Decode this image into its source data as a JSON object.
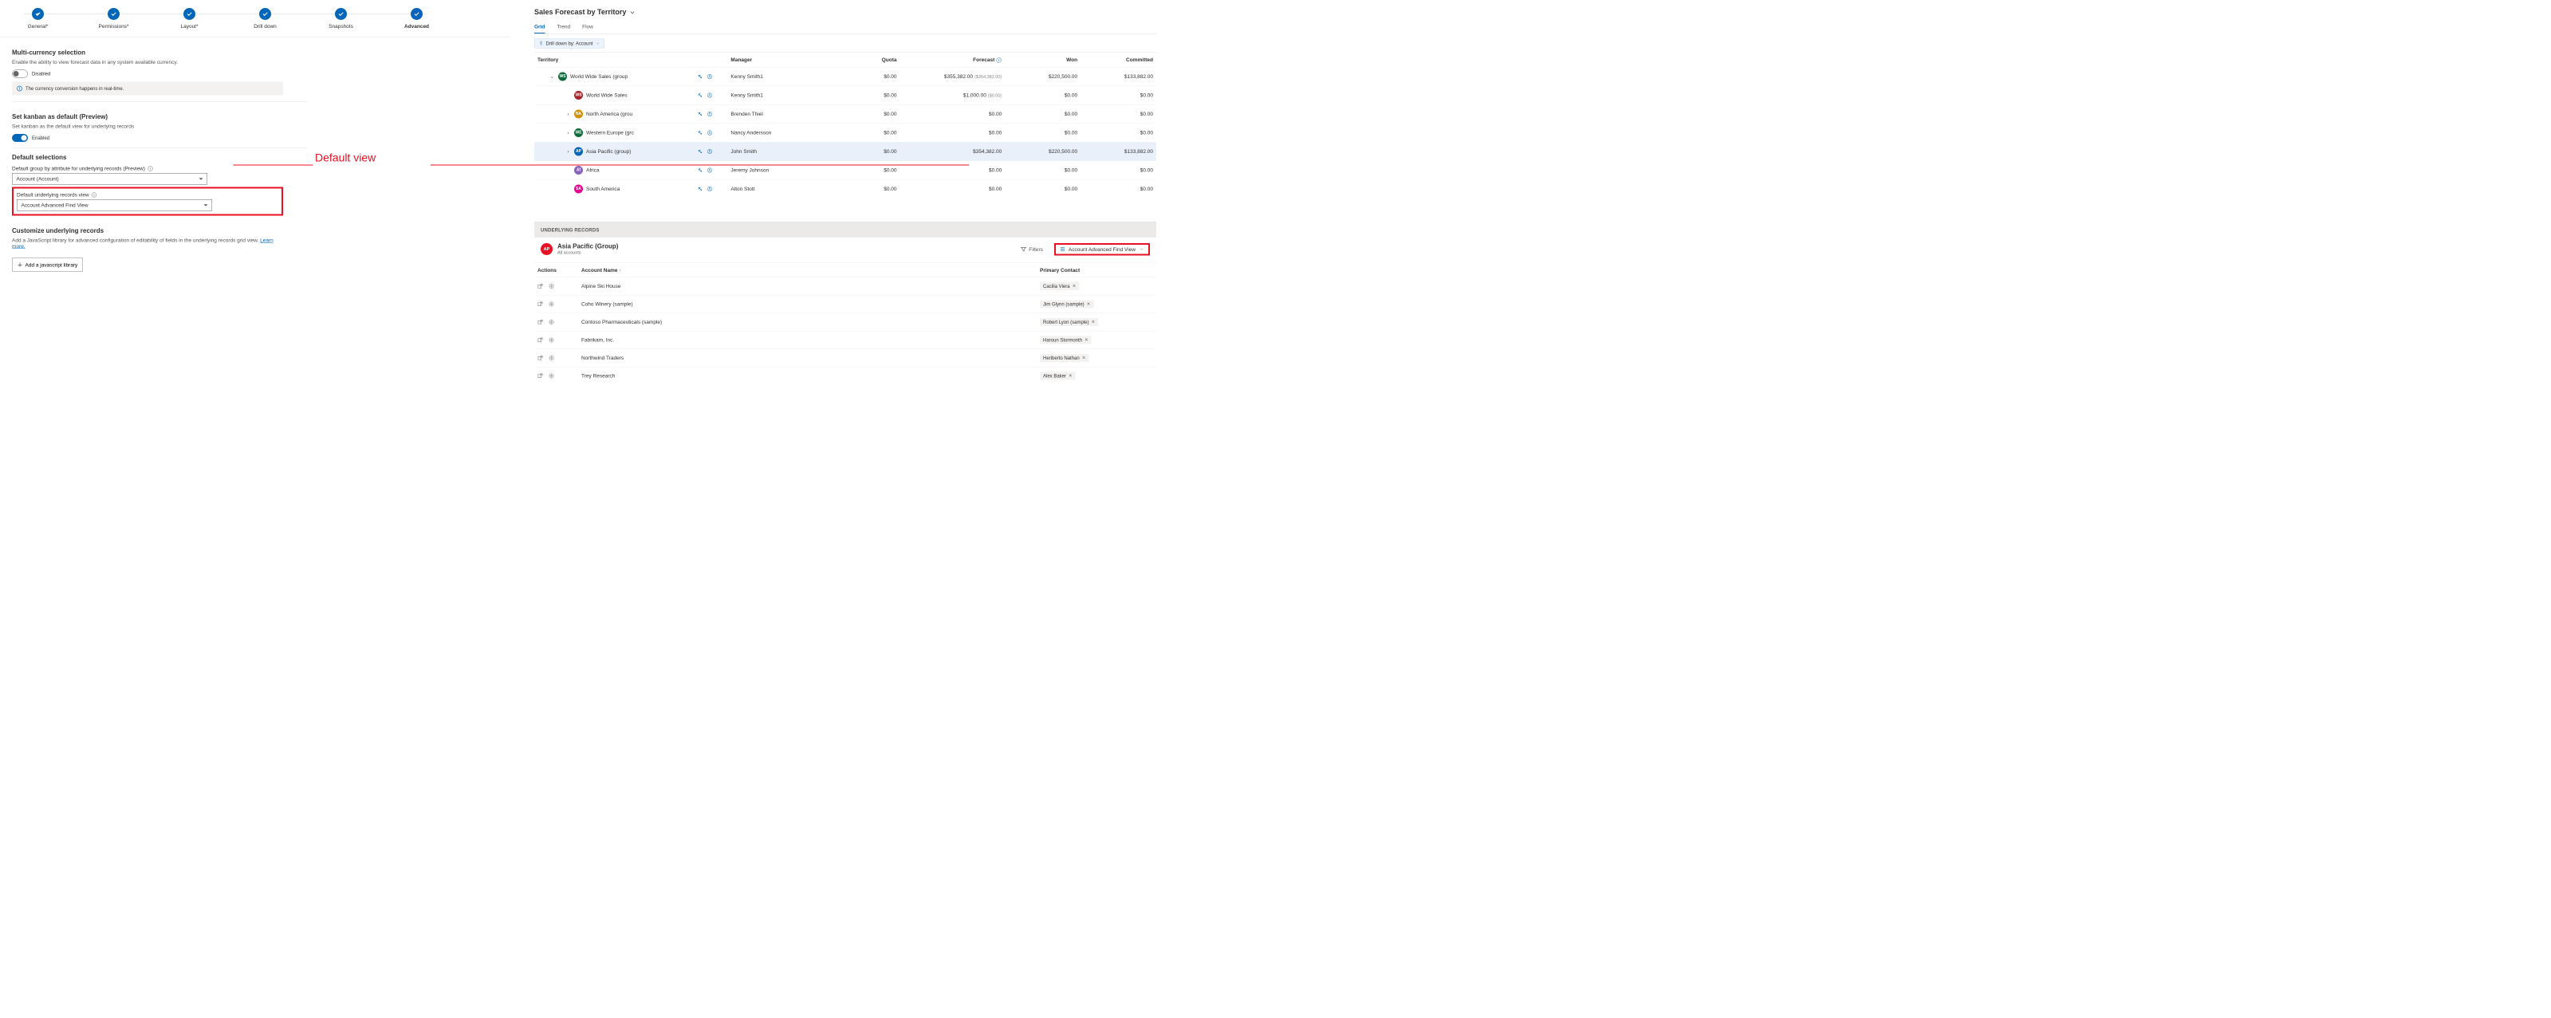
{
  "stepper": {
    "steps": [
      {
        "label": "General*"
      },
      {
        "label": "Permissions*"
      },
      {
        "label": "Layout*"
      },
      {
        "label": "Drill down"
      },
      {
        "label": "Snapshots"
      },
      {
        "label": "Advanced"
      }
    ]
  },
  "sections": {
    "multicurrency": {
      "title": "Multi-currency selection",
      "desc": "Enable the ability to view forecast data in any system available currency.",
      "toggle_state": "Disabled",
      "info": "The currency conversion happens in real-time."
    },
    "kanban": {
      "title": "Set kanban as default (Preview)",
      "desc": "Set kanban as the default view for underlying records",
      "toggle_state": "Enabled"
    },
    "defaults": {
      "title": "Default selections",
      "group_label": "Default group by attribute for underlying records (Preview)",
      "group_value": "Account (Account)",
      "view_label": "Default underlying records view",
      "view_value": "Account Advanced Find View"
    },
    "customize": {
      "title": "Customize underlying records",
      "desc": "Add a JavaScript library for advanced configuration of editability of fields in the underlying records grid view. ",
      "learn_more": "Learn more.",
      "button": "Add a javascript library"
    }
  },
  "annotation": {
    "text": "Default view"
  },
  "forecast": {
    "title": "Sales Forecast by Territory",
    "tabs": [
      "Grid",
      "Trend",
      "Flow"
    ],
    "drill_chip": "Drill down by: Account",
    "columns": {
      "territory": "Territory",
      "manager": "Manager",
      "quota": "Quota",
      "forecast": "Forecast",
      "won": "Won",
      "committed": "Committed"
    },
    "rows": [
      {
        "indent": 0,
        "expand": "down",
        "avatar": "WS",
        "avbg": "#0b6a3a",
        "name": "World Wide Sales (group",
        "manager": "Kenny Smith1",
        "quota": "$0.00",
        "forecast": "$355,382.00",
        "forecast_paren": "($354,382.00)",
        "won": "$220,500.00",
        "committed": "$133,882.00"
      },
      {
        "indent": 1,
        "expand": "",
        "avatar": "WS",
        "avbg": "#a4262c",
        "name": "World Wide Sales",
        "manager": "Kenny Smith1",
        "quota": "$0.00",
        "forecast": "$1,000.00",
        "forecast_paren": "($0.00)",
        "won": "$0.00",
        "committed": "$0.00"
      },
      {
        "indent": 1,
        "expand": "right",
        "avatar": "NA",
        "avbg": "#d29200",
        "name": "North America (grou",
        "manager": "Brenden Thiel",
        "quota": "$0.00",
        "forecast": "$0.00",
        "forecast_paren": "",
        "won": "$0.00",
        "committed": "$0.00"
      },
      {
        "indent": 1,
        "expand": "right",
        "avatar": "WE",
        "avbg": "#0b6a3a",
        "name": "Western Europe (grc",
        "manager": "Nancy Andersson",
        "quota": "$0.00",
        "forecast": "$0.00",
        "forecast_paren": "",
        "won": "$0.00",
        "committed": "$0.00"
      },
      {
        "indent": 1,
        "expand": "right",
        "avatar": "AP",
        "avbg": "#0067b8",
        "name": "Asia Pacific (group)",
        "manager": "John Smith",
        "quota": "$0.00",
        "forecast": "$354,382.00",
        "forecast_paren": "",
        "won": "$220,500.00",
        "committed": "$133,882.00",
        "highlight": true
      },
      {
        "indent": 1,
        "expand": "",
        "avatar": "Af",
        "avbg": "#8764b8",
        "name": "Africa",
        "manager": "Jeremy Johnson",
        "quota": "$0.00",
        "forecast": "$0.00",
        "forecast_paren": "",
        "won": "$0.00",
        "committed": "$0.00"
      },
      {
        "indent": 1,
        "expand": "",
        "avatar": "SA",
        "avbg": "#e3008c",
        "name": "South America",
        "manager": "Alton Stott",
        "quota": "$0.00",
        "forecast": "$0.00",
        "forecast_paren": "",
        "won": "$0.00",
        "committed": "$0.00"
      }
    ],
    "underlying": {
      "header": "UNDERLYING RECORDS",
      "group_avatar": "AP",
      "group_title": "Asia Pacific (Group)",
      "group_sub": "All accounts",
      "filters": "Filters",
      "view_name": "Account Advanced Find View",
      "columns": {
        "actions": "Actions",
        "account": "Account Name",
        "contact": "Primary Contact"
      },
      "rows": [
        {
          "name": "Alpine Ski House",
          "contact": "Cacilia Viera"
        },
        {
          "name": "Coho Winery (sample)",
          "contact": "Jim Glynn (sample)"
        },
        {
          "name": "Contoso Pharmaceuticals (sample)",
          "contact": "Robert Lyon (sample)"
        },
        {
          "name": "Fabrikam, Inc.",
          "contact": "Haroun Stormonth"
        },
        {
          "name": "Northwind Traders",
          "contact": "Heriberto Nathan"
        },
        {
          "name": "Trey Research",
          "contact": "Alex Baker"
        }
      ]
    }
  }
}
